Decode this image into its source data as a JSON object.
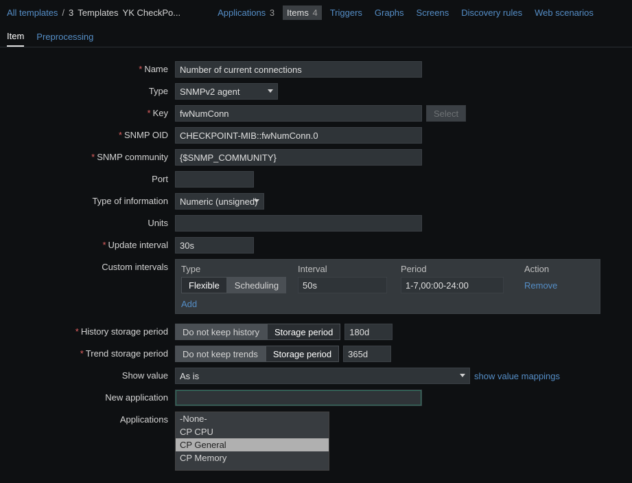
{
  "breadcrumb": {
    "all_templates": "All templates",
    "sep": "/",
    "template_count": "3",
    "template_label": "Templates",
    "current": "YK  CheckPo..."
  },
  "nav": {
    "applications": {
      "label": "Applications",
      "count": "3"
    },
    "items": {
      "label": "Items",
      "count": "4"
    },
    "triggers": {
      "label": "Triggers"
    },
    "graphs": {
      "label": "Graphs"
    },
    "screens": {
      "label": "Screens"
    },
    "discovery": {
      "label": "Discovery rules"
    },
    "web": {
      "label": "Web scenarios"
    }
  },
  "tabs": {
    "item": "Item",
    "preprocessing": "Preprocessing"
  },
  "labels": {
    "name": "Name",
    "type": "Type",
    "key": "Key",
    "snmp_oid": "SNMP OID",
    "snmp_community": "SNMP community",
    "port": "Port",
    "type_of_info": "Type of information",
    "units": "Units",
    "update_interval": "Update interval",
    "custom_intervals": "Custom intervals",
    "history_storage": "History storage period",
    "trend_storage": "Trend storage period",
    "show_value": "Show value",
    "new_application": "New application",
    "applications": "Applications"
  },
  "values": {
    "name": "Number of current connections",
    "type": "SNMPv2 agent",
    "key": "fwNumConn",
    "select_btn": "Select",
    "snmp_oid": "CHECKPOINT-MIB::fwNumConn.0",
    "snmp_community": "{$SNMP_COMMUNITY}",
    "port": "",
    "type_of_info": "Numeric (unsigned)",
    "units": "",
    "update_interval": "30s",
    "show_value_selected": "As is",
    "show_value_mappings_link": "show value mappings",
    "new_application": ""
  },
  "custom_intervals": {
    "heads": {
      "type": "Type",
      "interval": "Interval",
      "period": "Period",
      "action": "Action"
    },
    "seg": {
      "flexible": "Flexible",
      "scheduling": "Scheduling"
    },
    "row": {
      "interval": "50s",
      "period": "1-7,00:00-24:00",
      "remove": "Remove"
    },
    "add": "Add"
  },
  "history": {
    "do_not_keep": "Do not keep history",
    "storage_period": "Storage period",
    "value": "180d"
  },
  "trend": {
    "do_not_keep": "Do not keep trends",
    "storage_period": "Storage period",
    "value": "365d"
  },
  "applications_list": {
    "opt0": "-None-",
    "opt1": "CP CPU",
    "opt2": "CP General",
    "opt3": "CP Memory"
  }
}
